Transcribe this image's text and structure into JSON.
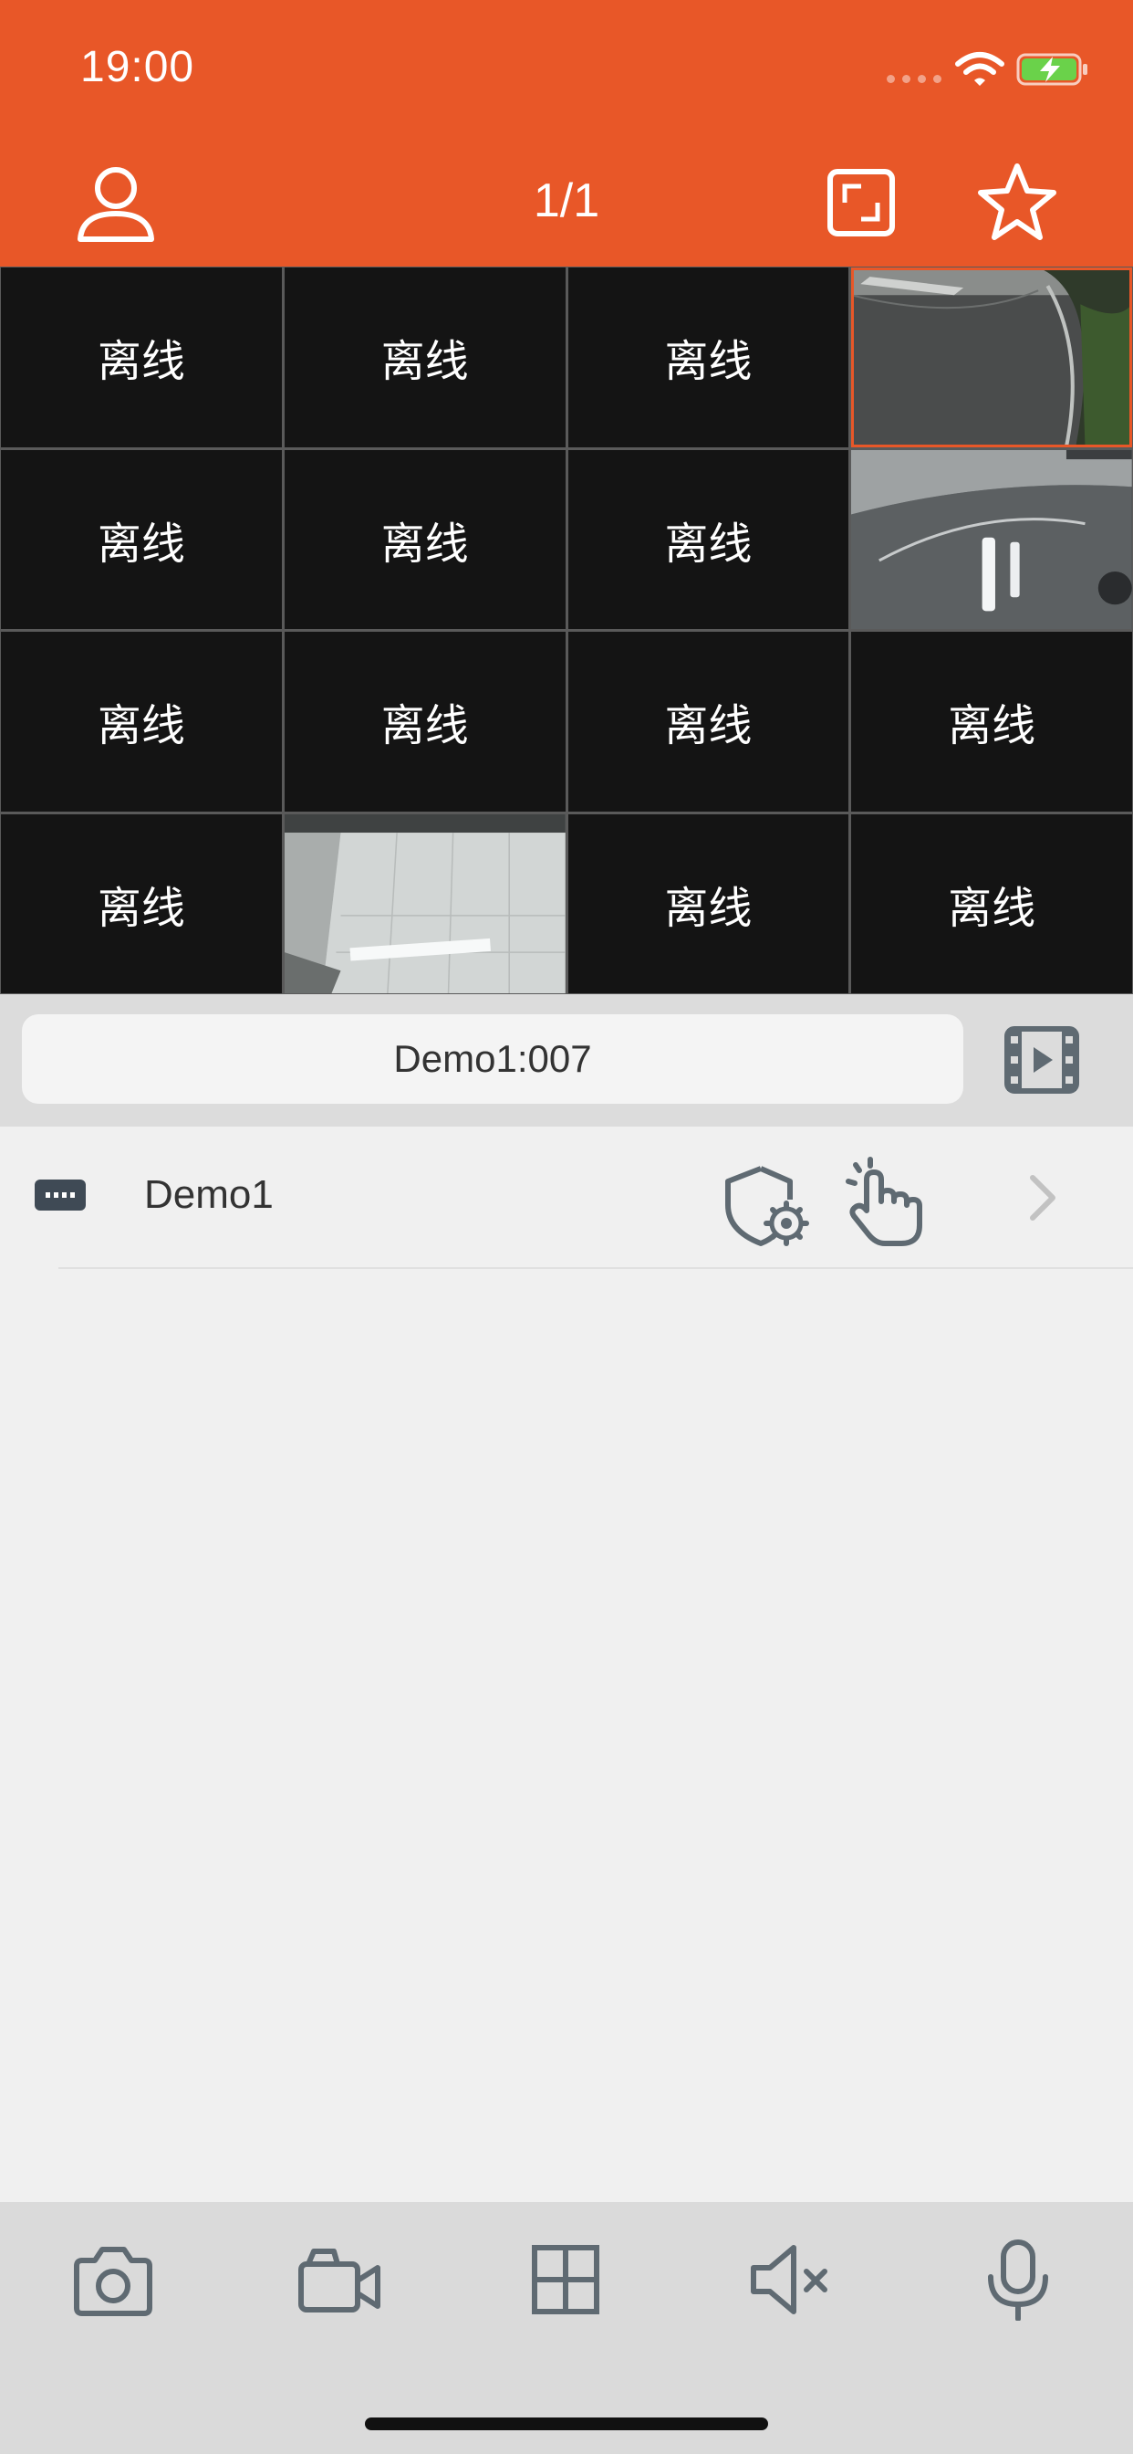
{
  "status_bar": {
    "time": "19:00"
  },
  "header": {
    "page_indicator": "1/1"
  },
  "grid": {
    "cells": [
      {
        "label": "离线",
        "type": "offline"
      },
      {
        "label": "离线",
        "type": "offline"
      },
      {
        "label": "离线",
        "type": "offline"
      },
      {
        "label": "",
        "type": "video",
        "selected": true
      },
      {
        "label": "离线",
        "type": "offline"
      },
      {
        "label": "离线",
        "type": "offline"
      },
      {
        "label": "离线",
        "type": "offline"
      },
      {
        "label": "",
        "type": "video"
      },
      {
        "label": "离线",
        "type": "offline"
      },
      {
        "label": "离线",
        "type": "offline"
      },
      {
        "label": "离线",
        "type": "offline"
      },
      {
        "label": "离线",
        "type": "offline"
      },
      {
        "label": "离线",
        "type": "offline"
      },
      {
        "label": "",
        "type": "video"
      },
      {
        "label": "离线",
        "type": "offline"
      },
      {
        "label": "离线",
        "type": "offline"
      }
    ]
  },
  "channel_bar": {
    "current_channel": "Demo1:007"
  },
  "device_list": [
    {
      "name": "Demo1"
    }
  ],
  "toolbar": {
    "icons": [
      "camera-icon",
      "video-record-icon",
      "grid-layout-icon",
      "speaker-mute-icon",
      "microphone-icon"
    ]
  },
  "colors": {
    "accent": "#e85728",
    "cell_bg": "#141414",
    "toolbar_bg": "#dadada"
  }
}
